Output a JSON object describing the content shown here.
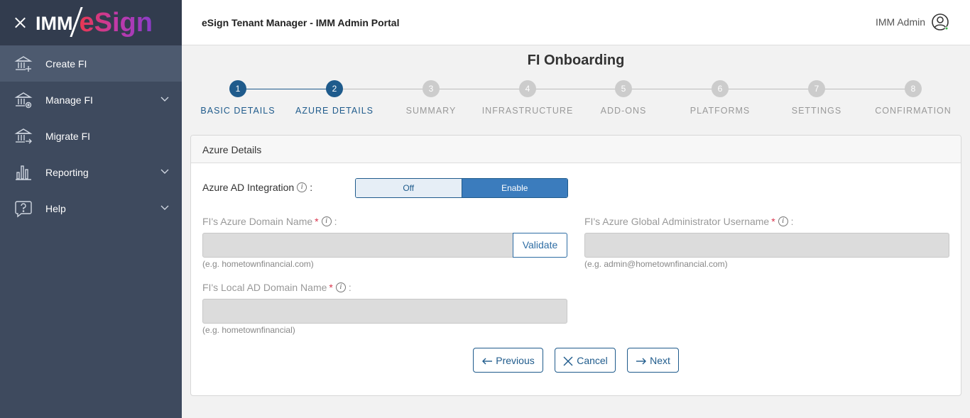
{
  "logo": {
    "left": "IMM",
    "right": "eSign"
  },
  "sidebar": {
    "items": [
      {
        "label": "Create FI",
        "icon": "bank-add-icon",
        "active": true,
        "expandable": false
      },
      {
        "label": "Manage FI",
        "icon": "bank-settings-icon",
        "active": false,
        "expandable": true
      },
      {
        "label": "Migrate FI",
        "icon": "bank-migrate-icon",
        "active": false,
        "expandable": false
      },
      {
        "label": "Reporting",
        "icon": "bar-chart-icon",
        "active": false,
        "expandable": true
      },
      {
        "label": "Help",
        "icon": "help-icon",
        "active": false,
        "expandable": true
      }
    ]
  },
  "header": {
    "title": "eSign Tenant Manager - IMM Admin Portal",
    "user_name": "IMM Admin"
  },
  "page": {
    "title": "FI Onboarding"
  },
  "stepper": {
    "current_step": 2,
    "steps": [
      {
        "number": "1",
        "label": "BASIC DETAILS"
      },
      {
        "number": "2",
        "label": "AZURE DETAILS"
      },
      {
        "number": "3",
        "label": "SUMMARY"
      },
      {
        "number": "4",
        "label": "INFRASTRUCTURE"
      },
      {
        "number": "5",
        "label": "ADD-ONS"
      },
      {
        "number": "6",
        "label": "PLATFORMS"
      },
      {
        "number": "7",
        "label": "SETTINGS"
      },
      {
        "number": "8",
        "label": "CONFIRMATION"
      }
    ]
  },
  "card": {
    "title": "Azure Details",
    "azure_ad": {
      "label": "Azure AD Integration",
      "off_label": "Off",
      "enable_label": "Enable",
      "selected": "Enable"
    },
    "domain_name": {
      "label": "FI's Azure Domain Name",
      "required": "*",
      "value": "",
      "hint": "(e.g. hometownfinancial.com)",
      "validate_label": "Validate"
    },
    "admin_username": {
      "label": "FI's Azure Global Administrator Username",
      "required": "*",
      "value": "",
      "hint": "(e.g. admin@hometownfinancial.com)"
    },
    "local_domain": {
      "label": "FI's Local AD Domain Name",
      "required": "*",
      "value": "",
      "hint": "(e.g. hometownfinancial)"
    }
  },
  "actions": {
    "previous": "Previous",
    "cancel": "Cancel",
    "next": "Next"
  },
  "colors": {
    "sidebar": "#3e4a5e",
    "primary": "#1f5b8c",
    "toggle_active": "#3b7cbd",
    "required": "#d9334b"
  }
}
